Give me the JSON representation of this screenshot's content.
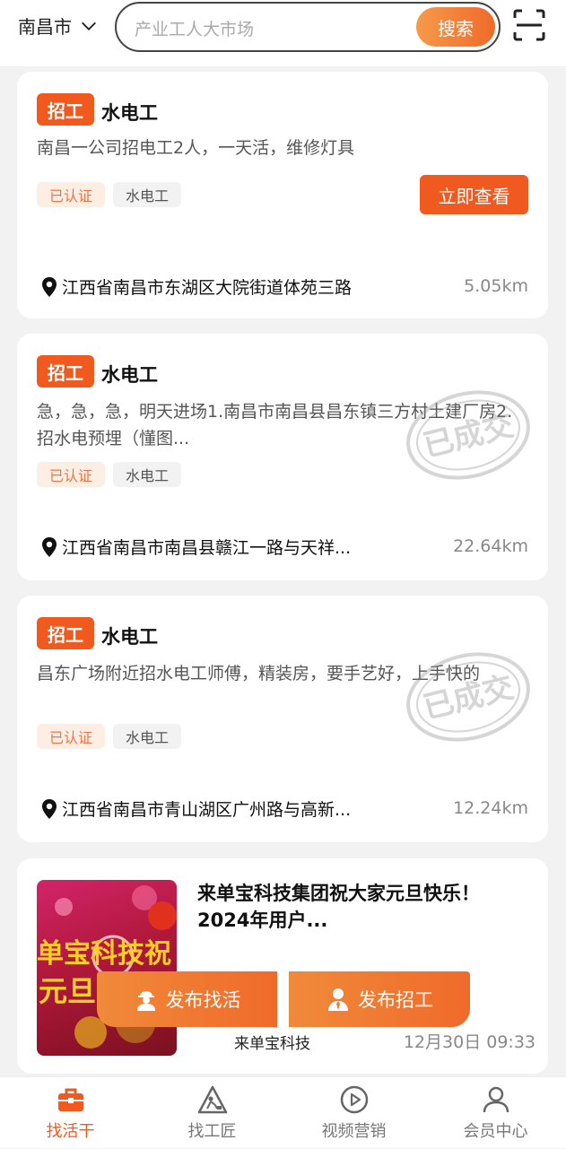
{
  "header": {
    "city": "南昌市",
    "search_placeholder": "产业工人大市场",
    "search_button": "搜索"
  },
  "jobs": [
    {
      "tag": "招工",
      "title": "水电工",
      "description": "南昌一公司招电工2人，一天活，维修灯具",
      "badges": [
        "已认证",
        "水电工"
      ],
      "action": "立即查看",
      "address": "江西省南昌市东湖区大院街道体苑三路",
      "distance": "5.05km",
      "stamp": ""
    },
    {
      "tag": "招工",
      "title": "水电工",
      "description": "急，急，急，明天进场1.南昌市南昌县昌东镇三方村土建厂房2.招水电预埋（懂图...",
      "badges": [
        "已认证",
        "水电工"
      ],
      "address": "江西省南昌市南昌县赣江一路与天祥...",
      "distance": "22.64km",
      "stamp": "已成交"
    },
    {
      "tag": "招工",
      "title": "水电工",
      "description": "昌东广场附近招水电工师傅，精装房，要手艺好，上手快的",
      "badges": [
        "已认证",
        "水电工"
      ],
      "address": "江西省南昌市青山湖区广州路与高新...",
      "distance": "12.24km",
      "stamp": "已成交"
    }
  ],
  "news": {
    "title": "来单宝科技集团祝大家元旦快乐！2024年用户...",
    "image_text_1": "单宝科技祝",
    "image_text_2": "元旦",
    "source": "来单宝科技",
    "time": "12月30日 09:33"
  },
  "floating_actions": {
    "find_work": "发布找活",
    "post_job": "发布招工"
  },
  "tabbar": [
    {
      "label": "找活干",
      "icon": "briefcase-icon",
      "active": true
    },
    {
      "label": "找工匠",
      "icon": "worker-sign-icon",
      "active": false
    },
    {
      "label": "视频营销",
      "icon": "play-circle-icon",
      "active": false
    },
    {
      "label": "会员中心",
      "icon": "user-icon",
      "active": false
    }
  ],
  "colors": {
    "accent": "#f05a1f",
    "cert_bg": "#fdeee4",
    "cert_text": "#e9774a"
  }
}
